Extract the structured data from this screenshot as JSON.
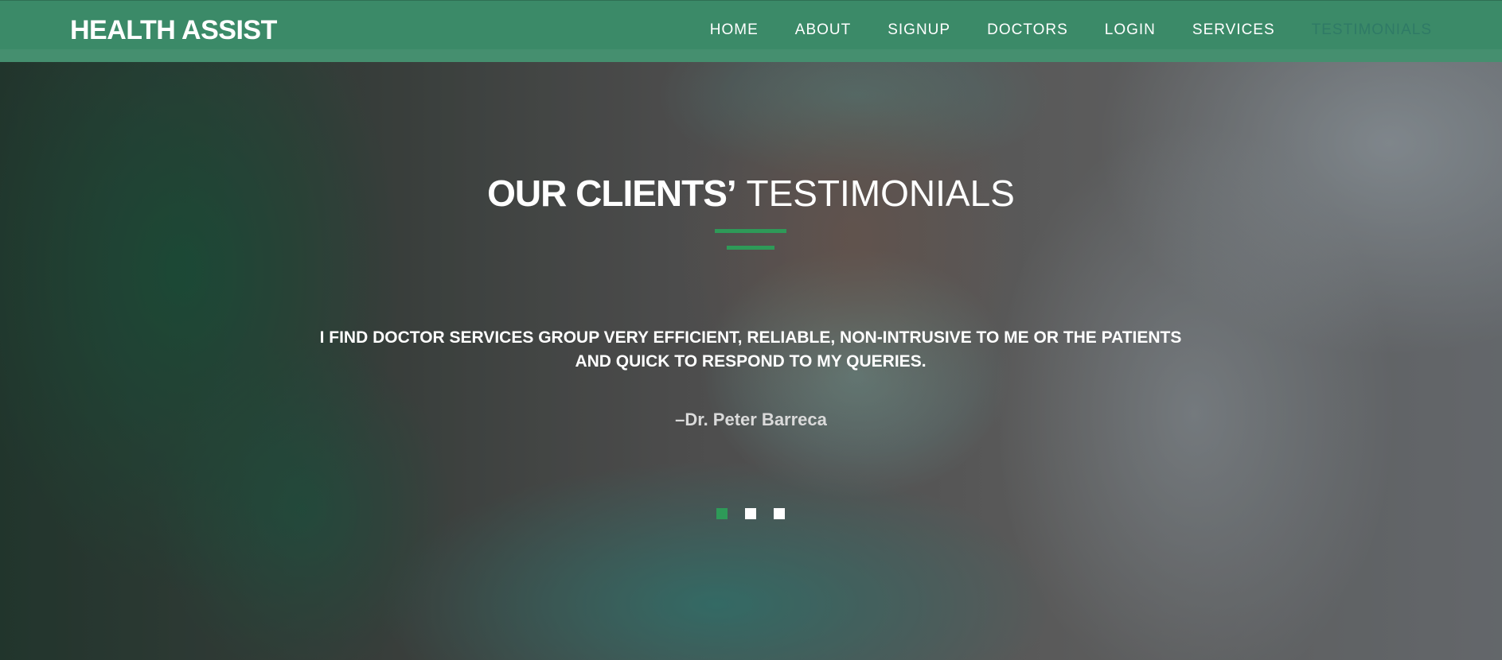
{
  "brand": {
    "title": "HEALTH ASSIST"
  },
  "nav": {
    "items": [
      {
        "label": "HOME"
      },
      {
        "label": "ABOUT"
      },
      {
        "label": "SIGNUP"
      },
      {
        "label": "DOCTORS"
      },
      {
        "label": "LOGIN"
      },
      {
        "label": "SERVICES"
      },
      {
        "label": "TESTIMONIALS",
        "active": true
      }
    ]
  },
  "section": {
    "heading_strong": "OUR CLIENTS’",
    "heading_light": "TESTIMONIALS"
  },
  "testimonial": {
    "quote": "I FIND DOCTOR SERVICES GROUP VERY EFFICIENT, RELIABLE, NON-INTRUSIVE TO ME OR THE PATIENTS AND QUICK TO RESPOND TO MY QUERIES.",
    "author": "–Dr. Peter Barreca"
  },
  "carousel": {
    "slide_count": 3,
    "active_index": 0
  },
  "colors": {
    "navbar": "#3b8a68",
    "accent": "#2e9a58",
    "active_nav": "#2f7a66"
  }
}
